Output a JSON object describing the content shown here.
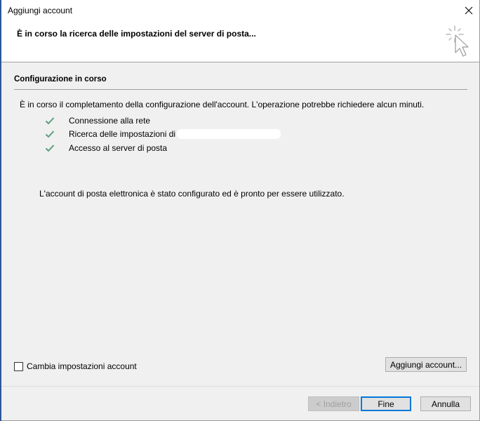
{
  "window": {
    "title": "Aggiungi account"
  },
  "header": {
    "status_text": "È in corso la ricerca delle impostazioni del server di posta..."
  },
  "section": {
    "title": "Configurazione in corso",
    "intro": "È in corso il completamento della configurazione dell'account. L'operazione potrebbe richiedere alcun minuti."
  },
  "steps": [
    {
      "label": "Connessione alla rete",
      "status": "done"
    },
    {
      "label": "Ricerca delle impostazioni di",
      "status": "done"
    },
    {
      "label": "Accesso al server di posta",
      "status": "done"
    }
  ],
  "result_message": "L'account di posta elettronica è stato configurato ed è pronto per essere utilizzato.",
  "change_settings": {
    "label": "Cambia impostazioni account",
    "checked": false
  },
  "buttons": {
    "add_account": "Aggiungi account...",
    "back": "< Indietro",
    "finish": "Fine",
    "cancel": "Annulla"
  },
  "colors": {
    "check": "#5a9e7c",
    "default_button_border": "#0078d7"
  }
}
